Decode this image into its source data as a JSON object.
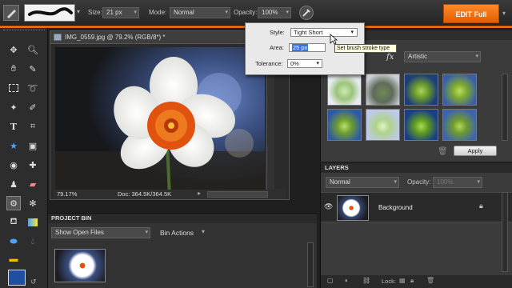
{
  "options": {
    "size_label": "Size:",
    "size_value": "21 px",
    "mode_label": "Mode:",
    "mode_value": "Normal",
    "opacity_label": "Opacity:",
    "opacity_value": "100%",
    "edit_full": "EDIT Full"
  },
  "popup": {
    "style_label": "Style:",
    "style_value": "Tight Short",
    "area_label": "Area:",
    "area_value": "25 px",
    "tolerance_label": "Tolerance:",
    "tolerance_value": "0%",
    "tooltip": "Set brush stroke type"
  },
  "document": {
    "title": "IMG_0559.jpg @ 79.2% (RGB/8*) *",
    "zoom": "79.17%",
    "doc_size": "Doc: 364.5K/364.5K"
  },
  "effects": {
    "fx_label": "fx",
    "category": "Artistic",
    "apply": "Apply"
  },
  "layers": {
    "title": "LAYERS",
    "blend_mode": "Normal",
    "opacity_label": "Opacity:",
    "opacity_value": "100%",
    "layer_name": "Background",
    "lock_label": "Lock:"
  },
  "bin": {
    "title": "PROJECT BIN",
    "source": "Show Open Files",
    "actions": "Bin Actions"
  },
  "colors": {
    "accent": "#e06a10",
    "panel": "#3b3b3b",
    "foreground_swatch": "#1f4fa0"
  }
}
